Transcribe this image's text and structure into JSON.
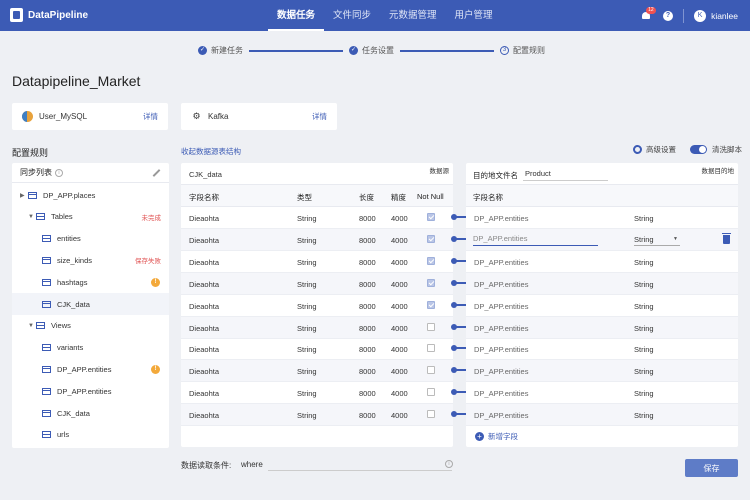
{
  "app": {
    "name": "DataPipeline"
  },
  "nav": {
    "items": [
      {
        "label": "数据任务",
        "active": true
      },
      {
        "label": "文件同步",
        "active": false
      },
      {
        "label": "元数据管理",
        "active": false
      },
      {
        "label": "用户管理",
        "active": false
      }
    ]
  },
  "header": {
    "notification_count": "12",
    "help": "?",
    "user_initial": "K",
    "username": "kianlee"
  },
  "steps": [
    {
      "label": "新建任务",
      "state": "done"
    },
    {
      "label": "任务设置",
      "state": "done"
    },
    {
      "label": "配置规则",
      "state": "current",
      "number": "3"
    }
  ],
  "page_title": "Datapipeline_Market",
  "source": {
    "name": "User_MySQL",
    "detail": "详情"
  },
  "destination": {
    "name": "Kafka",
    "detail": "详情"
  },
  "section_title": "配置规则",
  "sub_title": "收起数据源表结构",
  "advanced": {
    "label": "高级设置",
    "clean_label": "清洗脚本",
    "clean_on": true
  },
  "tree": {
    "title": "同步列表",
    "info": "i",
    "rows": [
      {
        "label": "DP_APP.places",
        "caret": "▶",
        "level": 0,
        "icon": "table"
      },
      {
        "label": "Tables",
        "caret": "▼",
        "level": 1,
        "icon": "table",
        "tag": "未完成"
      },
      {
        "label": "entities",
        "level": 2,
        "icon": "table"
      },
      {
        "label": "size_kinds",
        "level": 2,
        "icon": "table",
        "tag": "保存失败"
      },
      {
        "label": "hashtags",
        "level": 2,
        "icon": "table",
        "warn": "!"
      },
      {
        "label": "CJK_data",
        "level": 2,
        "icon": "table",
        "selected": true
      },
      {
        "label": "Views",
        "caret": "▼",
        "level": 1,
        "icon": "table"
      },
      {
        "label": "variants",
        "level": 2,
        "icon": "table"
      },
      {
        "label": "DP_APP.entities",
        "level": 2,
        "icon": "table",
        "warn": "!"
      },
      {
        "label": "DP_APP.entities",
        "level": 2,
        "icon": "table"
      },
      {
        "label": "CJK_data",
        "level": 2,
        "icon": "table"
      },
      {
        "label": "urls",
        "level": 2,
        "icon": "table"
      }
    ]
  },
  "source_table": {
    "corner": "数据源",
    "name": "CJK_data",
    "headers": {
      "field": "字段名称",
      "type": "类型",
      "length": "长度",
      "precision": "精度",
      "notnull": "Not Null"
    },
    "rows": [
      {
        "field": "Dieaohta",
        "type": "String",
        "length": "8000",
        "precision": "4000",
        "notnull": true
      },
      {
        "field": "Dieaohta",
        "type": "String",
        "length": "8000",
        "precision": "4000",
        "notnull": true
      },
      {
        "field": "Dieaohta",
        "type": "String",
        "length": "8000",
        "precision": "4000",
        "notnull": true
      },
      {
        "field": "Dieaohta",
        "type": "String",
        "length": "8000",
        "precision": "4000",
        "notnull": true
      },
      {
        "field": "Dieaohta",
        "type": "String",
        "length": "8000",
        "precision": "4000",
        "notnull": true
      },
      {
        "field": "Dieaohta",
        "type": "String",
        "length": "8000",
        "precision": "4000",
        "notnull": false
      },
      {
        "field": "Dieaohta",
        "type": "String",
        "length": "8000",
        "precision": "4000",
        "notnull": false
      },
      {
        "field": "Dieaohta",
        "type": "String",
        "length": "8000",
        "precision": "4000",
        "notnull": false
      },
      {
        "field": "Dieaohta",
        "type": "String",
        "length": "8000",
        "precision": "4000",
        "notnull": false
      },
      {
        "field": "Dieaohta",
        "type": "String",
        "length": "8000",
        "precision": "4000",
        "notnull": false
      }
    ]
  },
  "dest_table": {
    "corner": "数据目的地",
    "file_label": "目的地文件名",
    "file_value": "Product",
    "headers": {
      "field": "字段名称"
    },
    "rows": [
      {
        "field": "DP_APP.entities",
        "type": "String"
      },
      {
        "field": "DP_APP.entities",
        "type": "String",
        "editing": true
      },
      {
        "field": "DP_APP.entities",
        "type": "String"
      },
      {
        "field": "DP_APP.entities",
        "type": "String"
      },
      {
        "field": "DP_APP.entities",
        "type": "String"
      },
      {
        "field": "DP_APP.entities",
        "type": "String"
      },
      {
        "field": "DP_APP.entities",
        "type": "String"
      },
      {
        "field": "DP_APP.entities",
        "type": "String"
      },
      {
        "field": "DP_APP.entities",
        "type": "String"
      },
      {
        "field": "DP_APP.entities",
        "type": "String"
      }
    ],
    "add_label": "新增字段"
  },
  "bottom": {
    "condition_label": "数据读取条件:",
    "where": "where",
    "condition_value": "",
    "info": "i",
    "save_label": "保存"
  },
  "colors": {
    "primary": "#3c5bb5",
    "error": "#e05252",
    "warn": "#f3a93b"
  }
}
